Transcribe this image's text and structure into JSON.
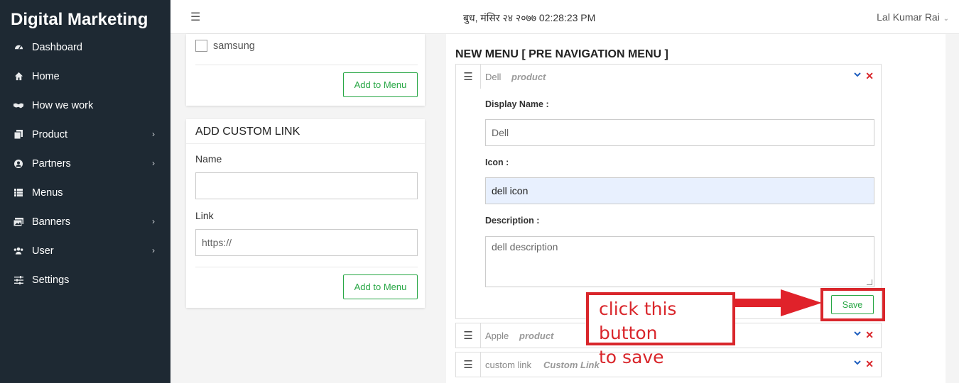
{
  "brand": "Digital Marketing",
  "sidebar": {
    "items": [
      {
        "label": "Dashboard",
        "icon": "dashboard-icon"
      },
      {
        "label": "Home",
        "icon": "home-icon"
      },
      {
        "label": "How we work",
        "icon": "handshake-icon"
      },
      {
        "label": "Product",
        "icon": "copy-icon",
        "has_children": true
      },
      {
        "label": "Partners",
        "icon": "user-circle-icon",
        "has_children": true
      },
      {
        "label": "Menus",
        "icon": "grid-icon"
      },
      {
        "label": "Banners",
        "icon": "image-icon",
        "has_children": true
      },
      {
        "label": "User",
        "icon": "users-icon",
        "has_children": true
      },
      {
        "label": "Settings",
        "icon": "sliders-icon"
      }
    ]
  },
  "topbar": {
    "datetime": "बुध, मंसिर २४ २०७७ 02:28:23 PM",
    "user_name": "Lal Kumar Rai"
  },
  "brands_card": {
    "checkbox_label": "samsung",
    "add_button": "Add to Menu"
  },
  "custom_link": {
    "title": "ADD CUSTOM LINK",
    "name_label": "Name",
    "name_value": "",
    "link_label": "Link",
    "link_placeholder": "https://",
    "add_button": "Add to Menu"
  },
  "menu": {
    "title": "NEW MENU [ PRE NAVIGATION MENU ]",
    "items": [
      {
        "name": "Dell",
        "type": "product"
      },
      {
        "name": "Apple",
        "type": "product"
      },
      {
        "name": "custom link",
        "type": "Custom Link"
      }
    ],
    "edit": {
      "display_name_label": "Display Name :",
      "display_name_value": "Dell",
      "icon_label": "Icon :",
      "icon_value": "dell icon",
      "description_label": "Description :",
      "description_value": "dell description",
      "save_button": "Save"
    }
  },
  "annotation": {
    "line1": "click this button",
    "line2": "to save"
  },
  "colors": {
    "sidebar_bg": "#1e2933",
    "accent_green": "#28a745",
    "annotation_red": "#d9262b",
    "focus_input_bg": "#e8f0fe"
  }
}
